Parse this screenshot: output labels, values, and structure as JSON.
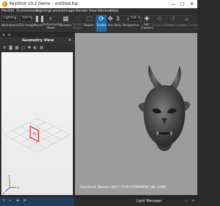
{
  "window": {
    "title": "KeyShot 10.2 Demo  -  untitled.bip",
    "controls": {
      "minimize": "—",
      "maximize": "☐",
      "close": "✕"
    }
  },
  "menu": [
    "File",
    "Edit",
    "Environment",
    "Lighting",
    "Camera",
    "Image",
    "Render",
    "View",
    "Window",
    "Help"
  ],
  "toolbar": {
    "preset_select": "Lighting",
    "zoom_value": "100 %",
    "fps_value": "E2E 4",
    "labels": {
      "workspaces": "Workspaces",
      "cpu_usage": "CPU Usage",
      "pause": "Pause",
      "performance_mode": "Performance Mode",
      "denoise": "Denoise",
      "render_region": "Render Region",
      "region": "Region",
      "tumble": "Tumble",
      "pan": "Pan",
      "dolly": "Dolly",
      "perspective": "Perspective",
      "add_camera": "Add Camera",
      "cycle_cameras": "Cycle Cameras",
      "reset_camera": "Reset Camera",
      "lock_camera": "Lock Camera"
    },
    "accent_color": "#1f6fb3"
  },
  "geometry_view": {
    "title": "Geometry View",
    "close_icon": "✕",
    "grid_color": "#9a9a9a",
    "camera_marker_color": "#d22020",
    "axes": {
      "x": "x",
      "y": "y",
      "z": "z"
    },
    "axis_colors": {
      "x": "#d83030",
      "y": "#26a526",
      "z": "#2c55d6"
    }
  },
  "viewport": {
    "watermark": "KeyShot Demo (NOT FOR COMMERCIAL USE)",
    "background_color": "#9c9c9c"
  },
  "bottom": {
    "left_tabs": [
      "≡",
      "▸",
      "◆",
      "⊞"
    ],
    "light_manager_title": "Light Manager",
    "controls": {
      "minimize": "—",
      "close": "✕"
    }
  }
}
